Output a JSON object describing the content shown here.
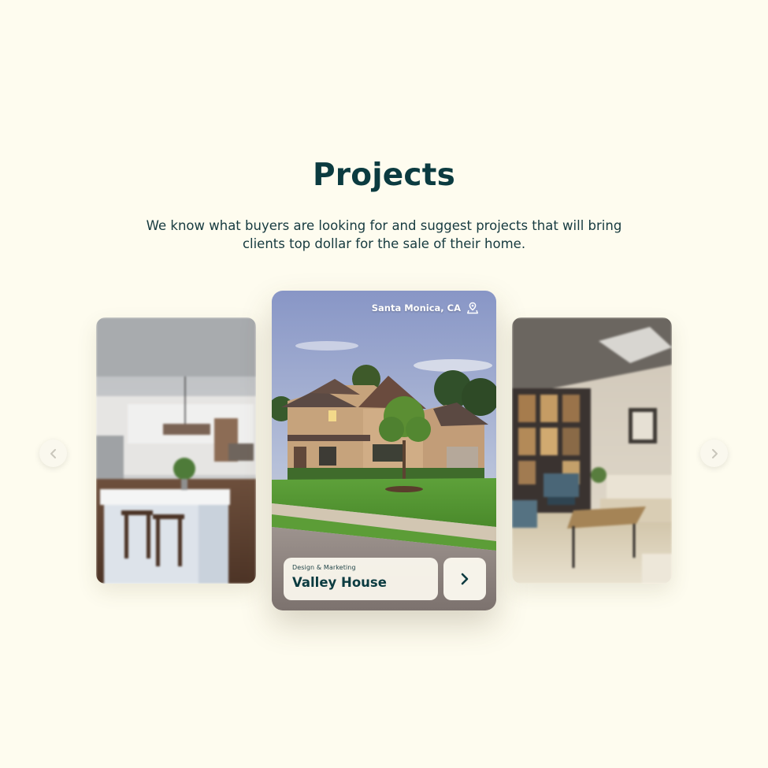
{
  "section": {
    "title": "Projects",
    "subtitle": "We know what buyers are looking for and suggest projects that will bring clients top dollar for the sale of their home."
  },
  "carousel": {
    "prev_icon": "chevron-left-icon",
    "next_icon": "chevron-right-icon",
    "cards": [
      {
        "id": "kitchen",
        "image": "kitchen-interior-photo"
      },
      {
        "id": "valley-house",
        "image": "suburban-house-photo",
        "location": "Santa Monica, CA",
        "location_icon": "location-pin-icon",
        "category": "Design & Marketing",
        "name": "Valley House",
        "action_icon": "chevron-right-icon"
      },
      {
        "id": "living-room",
        "image": "living-room-interior-photo"
      }
    ]
  },
  "colors": {
    "background": "#fefcef",
    "heading": "#0b3b40",
    "card_panel": "#faf7ed"
  }
}
